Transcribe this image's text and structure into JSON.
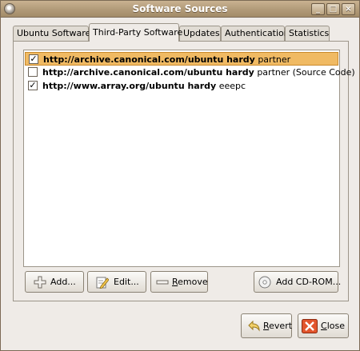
{
  "window": {
    "title": "Software Sources"
  },
  "tabs": [
    {
      "label": "Ubuntu Software"
    },
    {
      "label": "Third-Party Software"
    },
    {
      "label": "Updates"
    },
    {
      "label": "Authentication"
    },
    {
      "label": "Statistics"
    }
  ],
  "sources": [
    {
      "uri": "http://archive.canonical.com/ubuntu hardy",
      "component": "partner",
      "checked": "✓"
    },
    {
      "uri": "http://archive.canonical.com/ubuntu hardy",
      "component": "partner (Source Code)",
      "checked": ""
    },
    {
      "uri": "http://www.array.org/ubuntu hardy",
      "component": "eeepc",
      "checked": "✓"
    }
  ],
  "buttons": {
    "add": {
      "pre": "Add",
      "accel": "",
      "post": "..."
    },
    "edit": {
      "pre": "Edit",
      "accel": "",
      "post": "..."
    },
    "remove": {
      "pre": "",
      "accel": "R",
      "post": "emove"
    },
    "cdrom": {
      "pre": "Add CD-ROM",
      "accel": "",
      "post": "..."
    },
    "revert": {
      "pre": "",
      "accel": "R",
      "post": "evert"
    },
    "close": {
      "pre": "",
      "accel": "C",
      "post": "lose"
    }
  },
  "colors": {
    "titlebar": "#b19a78",
    "selection": "#f0ba63",
    "close_accent": "#e2552c"
  }
}
